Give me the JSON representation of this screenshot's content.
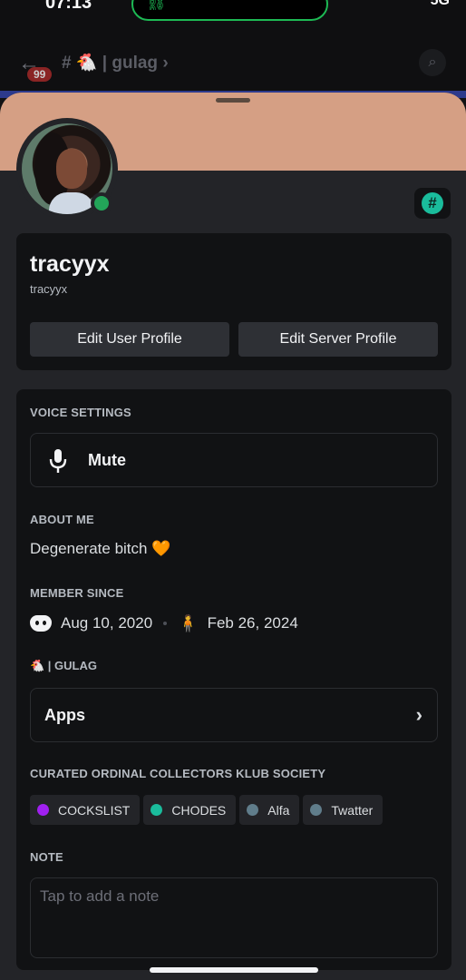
{
  "status_bar": {
    "time": "07:13",
    "network": "5G"
  },
  "background": {
    "unread_badge": "99",
    "channel_title": "# 🐔 | gulag ›"
  },
  "profile": {
    "display_name": "tracyyx",
    "username": "tracyyx",
    "edit_user_label": "Edit User Profile",
    "edit_server_label": "Edit Server Profile",
    "status": "online",
    "banner_color": "#d59f84",
    "status_color": "#23a559"
  },
  "sections": {
    "voice_settings": "VOICE SETTINGS",
    "mute_label": "Mute",
    "about_me": "ABOUT ME",
    "about_text": "Degenerate bitch",
    "about_emoji": "🧡",
    "member_since": "MEMBER SINCE",
    "discord_date": "Aug 10, 2020",
    "server_date": "Feb 26, 2024",
    "server_emoji": "🐔",
    "server_name": "🐔 | GULAG",
    "apps_label": "Apps",
    "roles_header": "CURATED ORDINAL COLLECTORS KLUB SOCIETY",
    "note_header": "NOTE",
    "note_placeholder": "Tap to add a note"
  },
  "roles": [
    {
      "name": "COCKSLIST",
      "color": "#a020f0"
    },
    {
      "name": "CHODES",
      "color": "#1abc9c"
    },
    {
      "name": "Alfa",
      "color": "#607d8b"
    },
    {
      "name": "Twatter",
      "color": "#607d8b"
    }
  ]
}
